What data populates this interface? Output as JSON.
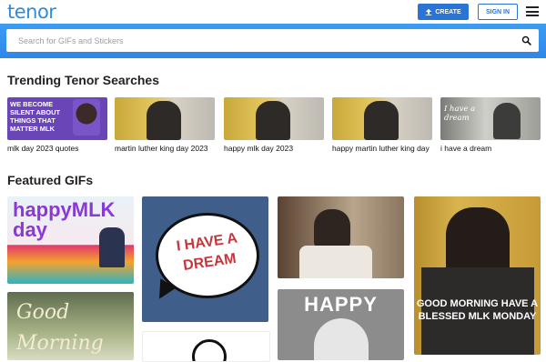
{
  "header": {
    "logo": "tenor",
    "create_label": "CREATE",
    "signin_label": "SIGN IN"
  },
  "search": {
    "placeholder": "Search for GIFs and Stickers"
  },
  "trending": {
    "title": "Trending Tenor Searches",
    "items": [
      {
        "label": "mlk day 2023 quotes",
        "thumb_text": "WE BECOME SILENT ABOUT THINGS THAT MATTER MLK"
      },
      {
        "label": "martin luther king day 2023"
      },
      {
        "label": "happy mlk day 2023"
      },
      {
        "label": "happy martin luther king day"
      },
      {
        "label": "i have a dream",
        "thumb_text": "I have a dream"
      }
    ]
  },
  "featured": {
    "title": "Featured GIFs",
    "gifs": [
      {
        "text": "happyMLK day"
      },
      {
        "text": "I HAVE A DREAM"
      },
      {
        "text": ""
      },
      {
        "text": "GOOD MORNING HAVE A BLESSED MLK MONDAY"
      },
      {
        "text": "Good Morning"
      },
      {
        "text": "HAPPY"
      },
      {
        "text": ""
      }
    ]
  },
  "colors": {
    "brand_blue": "#2f8cdb",
    "button_blue": "#2a74d6",
    "search_band": "#3b9df3"
  }
}
